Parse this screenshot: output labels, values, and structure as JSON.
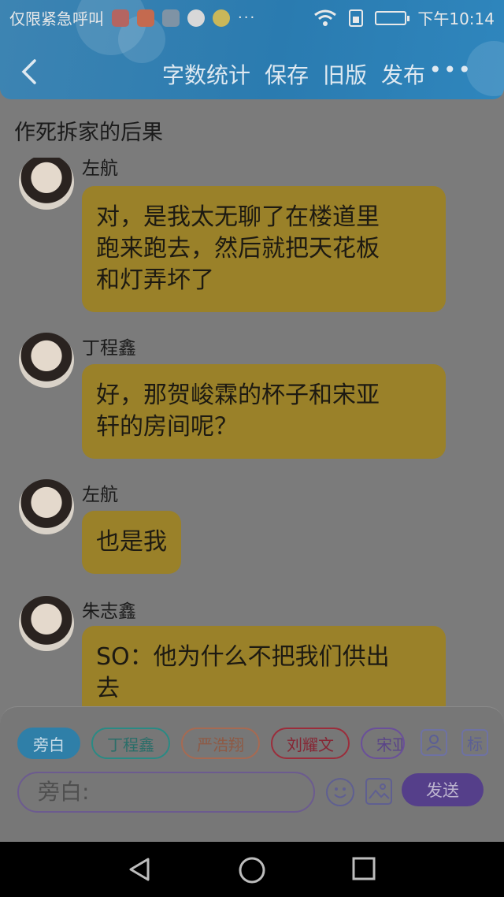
{
  "status_bar": {
    "carrier_text": "仅限紧急呼叫",
    "time": "下午10:14"
  },
  "header": {
    "actions": [
      "字数统计",
      "保存",
      "旧版",
      "发布"
    ],
    "more_label": "•••"
  },
  "story_title": "作死拆家的后果",
  "messages": [
    {
      "speaker": "左航",
      "lines": [
        "对，是我太无聊了在楼道里",
        "跑来跑去，然后就把天花板",
        "和灯弄坏了"
      ]
    },
    {
      "speaker": "丁程鑫",
      "lines": [
        "好，那贺峻霖的杯子和宋亚",
        "轩的房间呢？"
      ]
    },
    {
      "speaker": "左航",
      "lines": [
        "也是我"
      ]
    },
    {
      "speaker": "朱志鑫",
      "lines": [
        "SO：他为什么不把我们供出",
        "去"
      ]
    }
  ],
  "character_chips": [
    {
      "label": "旁白",
      "color": "#2f7fa8",
      "active": true
    },
    {
      "label": "丁程鑫",
      "color": "#2a8a84",
      "active": false
    },
    {
      "label": "严浩翔",
      "color": "#a76a52",
      "active": false
    },
    {
      "label": "刘耀文",
      "color": "#9b2d3b",
      "active": false
    },
    {
      "label": "宋亚",
      "color": "#6a4f9a",
      "active": false
    }
  ],
  "tools": {
    "mark_label": "标"
  },
  "composer": {
    "placeholder": "旁白:",
    "send_label": "发送"
  },
  "colors": {
    "bubble": "#9a8129",
    "header": "#2a7bb0",
    "send": "#553f8a"
  }
}
